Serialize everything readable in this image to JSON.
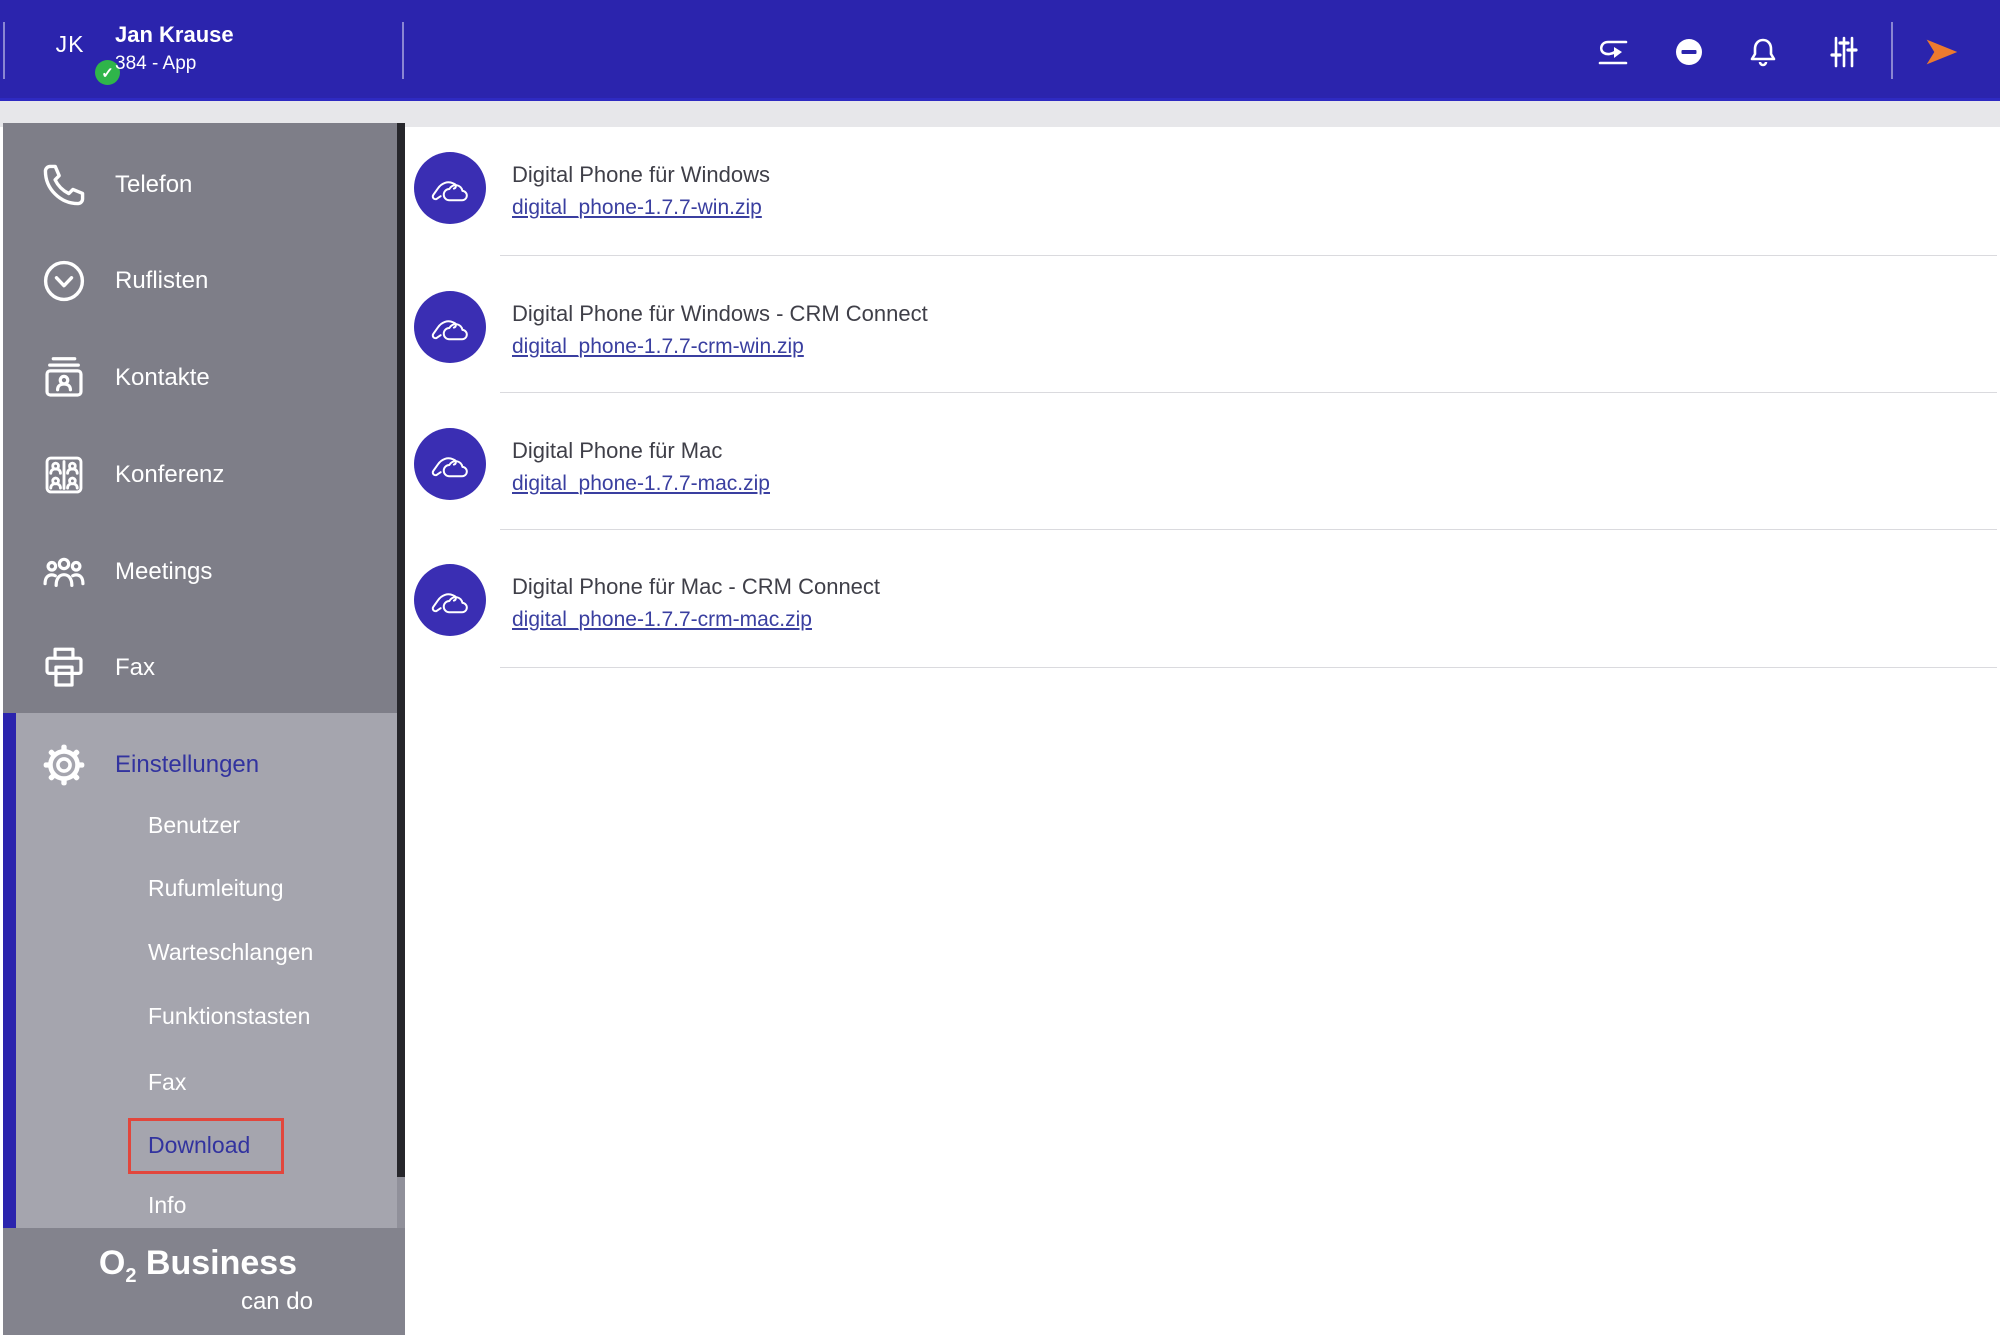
{
  "topbar": {
    "user": {
      "initials": "JK",
      "name": "Jan Krause",
      "subtitle": "384 - App"
    }
  },
  "sidebar": {
    "items": [
      {
        "label": "Telefon"
      },
      {
        "label": "Ruflisten"
      },
      {
        "label": "Kontakte"
      },
      {
        "label": "Konferenz"
      },
      {
        "label": "Meetings"
      },
      {
        "label": "Fax"
      }
    ],
    "settings": {
      "label": "Einstellungen",
      "subitems": [
        {
          "label": "Benutzer"
        },
        {
          "label": "Rufumleitung"
        },
        {
          "label": "Warteschlangen"
        },
        {
          "label": "Funktionstasten"
        },
        {
          "label": "Fax"
        },
        {
          "label": "Download"
        },
        {
          "label": "Info"
        }
      ]
    },
    "logo": {
      "brand_o": "O",
      "brand_sub": "2",
      "brand_rest": "Business",
      "tagline": "can do"
    }
  },
  "downloads": [
    {
      "title": "Digital Phone für Windows",
      "file": "digital_phone-1.7.7-win.zip"
    },
    {
      "title": "Digital Phone für Windows - CRM Connect",
      "file": "digital_phone-1.7.7-crm-win.zip"
    },
    {
      "title": "Digital Phone für Mac",
      "file": "digital_phone-1.7.7-mac.zip"
    },
    {
      "title": "Digital Phone für Mac - CRM Connect",
      "file": "digital_phone-1.7.7-crm-mac.zip"
    }
  ],
  "colors": {
    "topbar": "#2b24ad",
    "accent_indigo": "#32339f",
    "link": "#3a3fa0",
    "highlight_red": "#e2463c",
    "icon_circle": "#3a2eb3",
    "presence_green": "#2fb54a",
    "send_orange": "#ed7a2e"
  }
}
